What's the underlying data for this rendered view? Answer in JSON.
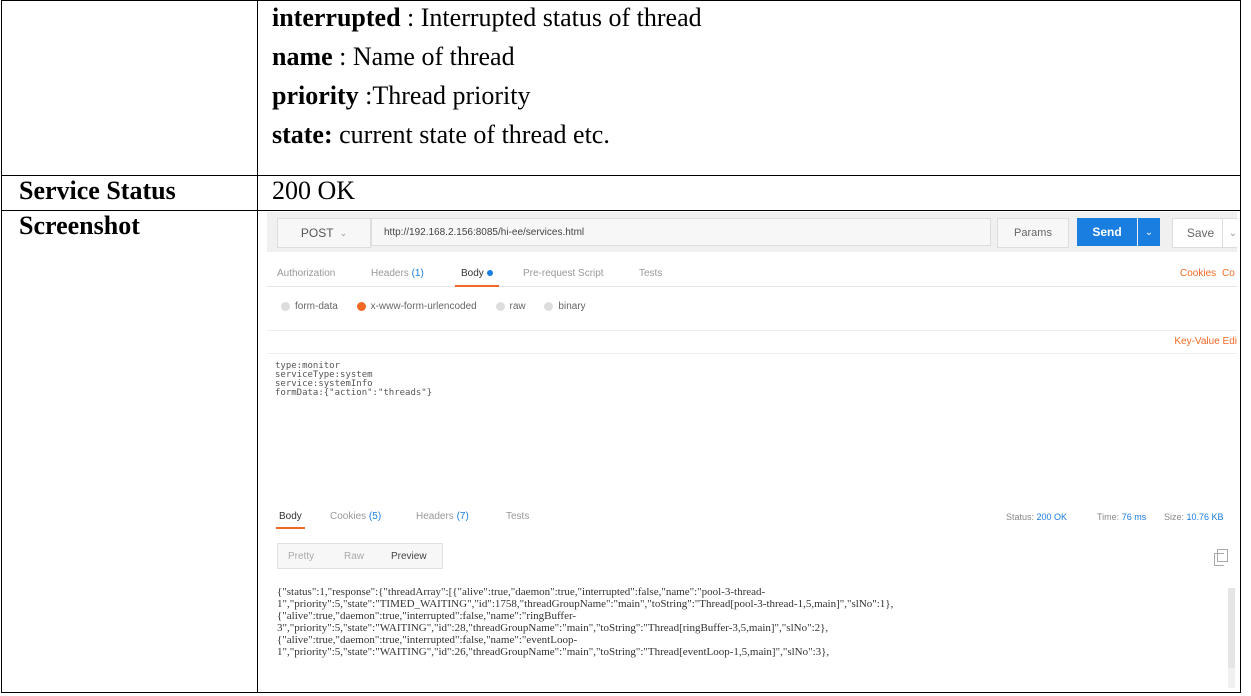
{
  "doc": {
    "desc_lines": [
      {
        "term": "interrupted",
        "text": " : Interrupted status of thread"
      },
      {
        "term": "name",
        "text": " : Name of thread"
      },
      {
        "term": "priority",
        "text": " :Thread priority"
      },
      {
        "term": "state:",
        "text": " current state of thread etc."
      }
    ],
    "service_status_label": "Service Status",
    "service_status_value": "200 OK",
    "screenshot_label": "Screenshot"
  },
  "postman": {
    "method": "POST",
    "url": "http://192.168.2.156:8085/hi-ee/services.html",
    "params_label": "Params",
    "send_label": "Send",
    "save_label": "Save",
    "request_tabs": [
      {
        "label": "Authorization",
        "count": ""
      },
      {
        "label": "Headers",
        "count": "(1)"
      },
      {
        "label": "Body",
        "count": ""
      },
      {
        "label": "Pre-request Script",
        "count": ""
      },
      {
        "label": "Tests",
        "count": ""
      }
    ],
    "cookies_label": "Cookies",
    "code_label_partial": "Co",
    "body_types": [
      "form-data",
      "x-www-form-urlencoded",
      "raw",
      "binary"
    ],
    "key_value_label": "Key-Value Edi",
    "body_lines": [
      "type:monitor",
      "serviceType:system",
      "service:systemInfo",
      "formData:{\"action\":\"threads\"}"
    ],
    "response_tabs": [
      {
        "label": "Body",
        "count": ""
      },
      {
        "label": "Cookies",
        "count": "(5)"
      },
      {
        "label": "Headers",
        "count": "(7)"
      },
      {
        "label": "Tests",
        "count": ""
      }
    ],
    "status_label": "Status:",
    "status_value": "200 OK",
    "time_label": "Time:",
    "time_value": "76 ms",
    "size_label": "Size:",
    "size_value": "10.76 KB",
    "view_modes": [
      "Pretty",
      "Raw",
      "Preview"
    ],
    "response_lines": [
      "{\"status\":1,\"response\":{\"threadArray\":[{\"alive\":true,\"daemon\":true,\"interrupted\":false,\"name\":\"pool-3-thread-",
      "1\",\"priority\":5,\"state\":\"TIMED_WAITING\",\"id\":1758,\"threadGroupName\":\"main\",\"toString\":\"Thread[pool-3-thread-1,5,main]\",\"slNo\":1},",
      "{\"alive\":true,\"daemon\":true,\"interrupted\":false,\"name\":\"ringBuffer-",
      "3\",\"priority\":5,\"state\":\"WAITING\",\"id\":28,\"threadGroupName\":\"main\",\"toString\":\"Thread[ringBuffer-3,5,main]\",\"slNo\":2},",
      "{\"alive\":true,\"daemon\":true,\"interrupted\":false,\"name\":\"eventLoop-",
      "1\",\"priority\":5,\"state\":\"WAITING\",\"id\":26,\"threadGroupName\":\"main\",\"toString\":\"Thread[eventLoop-1,5,main]\",\"slNo\":3},"
    ]
  }
}
